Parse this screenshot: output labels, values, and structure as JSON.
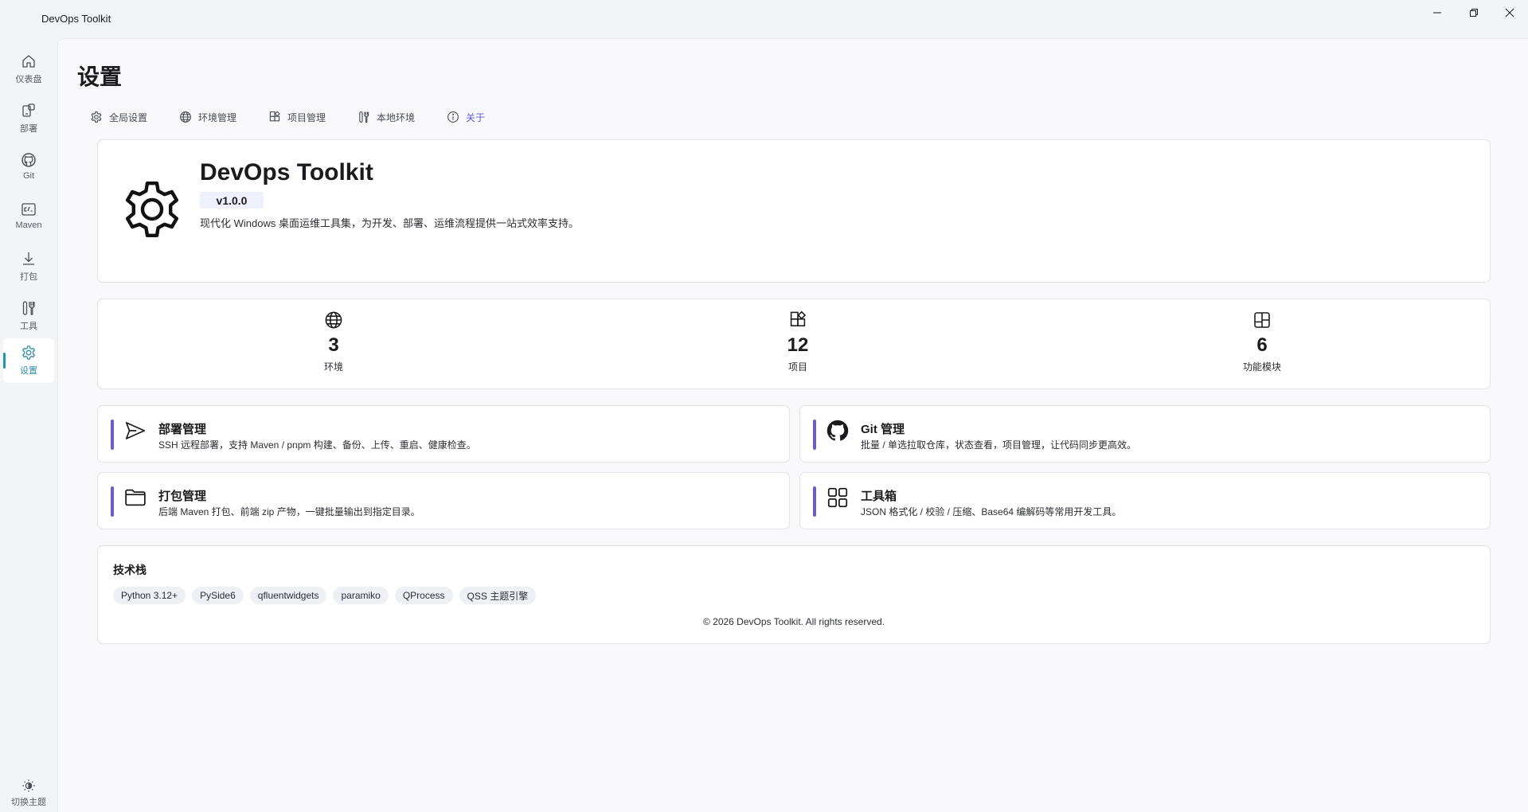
{
  "window": {
    "title": "DevOps Toolkit"
  },
  "sidebar": {
    "items": [
      {
        "label": "仪表盘",
        "icon": "home-icon"
      },
      {
        "label": "部署",
        "icon": "deploy-icon"
      },
      {
        "label": "Git",
        "icon": "github-icon"
      },
      {
        "label": "Maven",
        "icon": "terminal-icon"
      },
      {
        "label": "打包",
        "icon": "download-icon"
      },
      {
        "label": "工具",
        "icon": "tools-icon"
      },
      {
        "label": "设置",
        "icon": "gear-icon",
        "active": true
      }
    ],
    "theme_toggle_label": "切换主题"
  },
  "page": {
    "title": "设置",
    "tabs": [
      {
        "label": "全局设置",
        "icon": "gear-icon"
      },
      {
        "label": "环境管理",
        "icon": "globe-icon"
      },
      {
        "label": "项目管理",
        "icon": "apps-icon"
      },
      {
        "label": "本地环境",
        "icon": "tools-icon"
      },
      {
        "label": "关于",
        "icon": "info-icon",
        "active": true
      }
    ]
  },
  "about": {
    "name": "DevOps Toolkit",
    "version": "v1.0.0",
    "description": "现代化 Windows 桌面运维工具集，为开发、部署、运维流程提供一站式效率支持。"
  },
  "stats": [
    {
      "value": "3",
      "label": "环境",
      "icon": "globe-icon"
    },
    {
      "value": "12",
      "label": "项目",
      "icon": "apps-icon"
    },
    {
      "value": "6",
      "label": "功能模块",
      "icon": "layout-icon"
    }
  ],
  "features": [
    {
      "title": "部署管理",
      "description": "SSH 远程部署，支持 Maven / pnpm 构建、备份、上传、重启、健康检查。",
      "icon": "send-icon"
    },
    {
      "title": "Git 管理",
      "description": "批量 / 单选拉取仓库，状态查看，项目管理，让代码同步更高效。",
      "icon": "github-icon"
    },
    {
      "title": "打包管理",
      "description": "后端 Maven 打包、前端 zip 产物，一键批量输出到指定目录。",
      "icon": "folder-icon"
    },
    {
      "title": "工具箱",
      "description": "JSON 格式化 / 校验 / 压缩、Base64 编解码等常用开发工具。",
      "icon": "toolbox-icon"
    }
  ],
  "tech_stack": {
    "title": "技术栈",
    "items": [
      "Python 3.12+",
      "PySide6",
      "qfluentwidgets",
      "paramiko",
      "QProcess",
      "QSS 主题引擎"
    ],
    "copyright": "© 2026 DevOps Toolkit. All rights reserved."
  },
  "colors": {
    "accent": "#6a5ad8",
    "nav_active": "#1a9aaa",
    "background": "#f3f4f7"
  }
}
